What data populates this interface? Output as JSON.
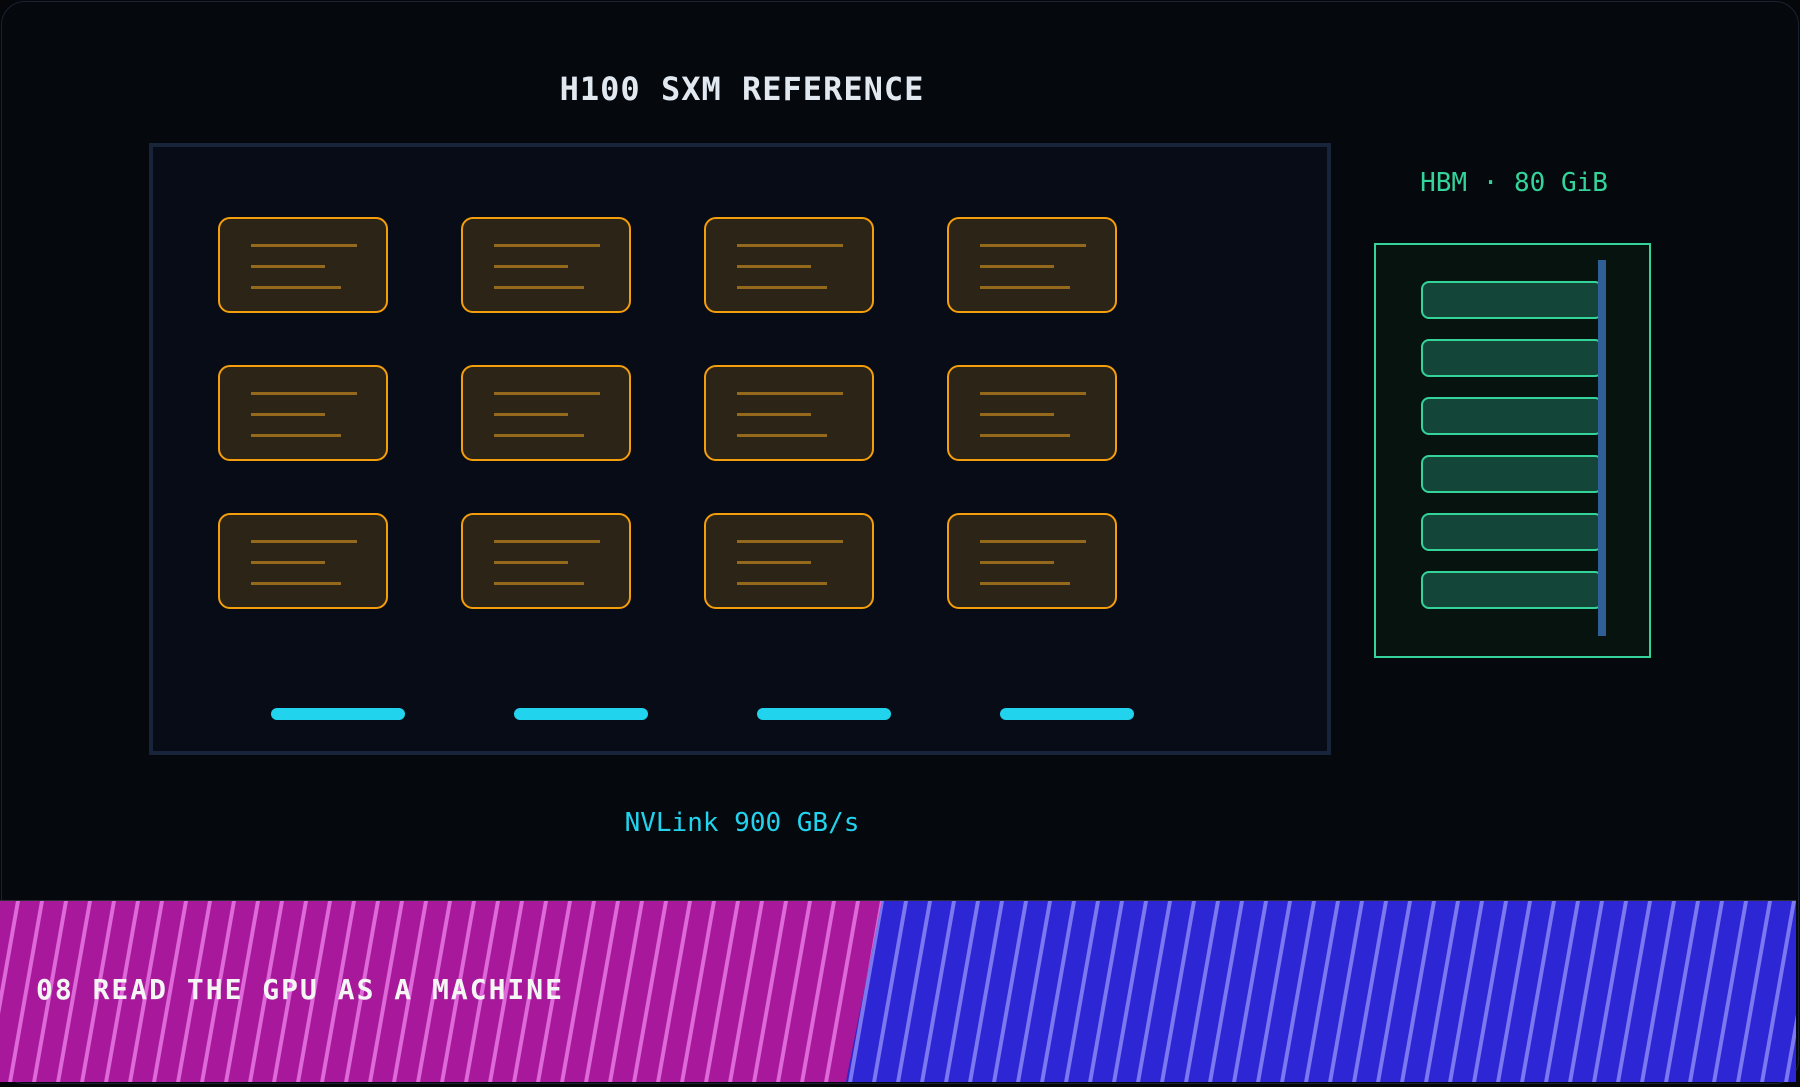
{
  "title": "H100 SXM REFERENCE",
  "die": {
    "sm_grid": {
      "rows": 3,
      "cols": 4
    },
    "nvlink_port_count": 4
  },
  "nvlink": {
    "label": "NVLink 900 GB/s"
  },
  "hbm": {
    "label": "HBM · 80 GiB",
    "stack_count": 6
  },
  "banner": {
    "label": "08 READ THE GPU AS A MACHINE"
  },
  "colors": {
    "background": "#05080d",
    "sm_border": "#f59e0b",
    "sm_fill": "#2c2417",
    "nvlink": "#22d3ee",
    "hbm": "#34d399",
    "banner_left": "#a8189a",
    "banner_right": "#2d26d4"
  }
}
